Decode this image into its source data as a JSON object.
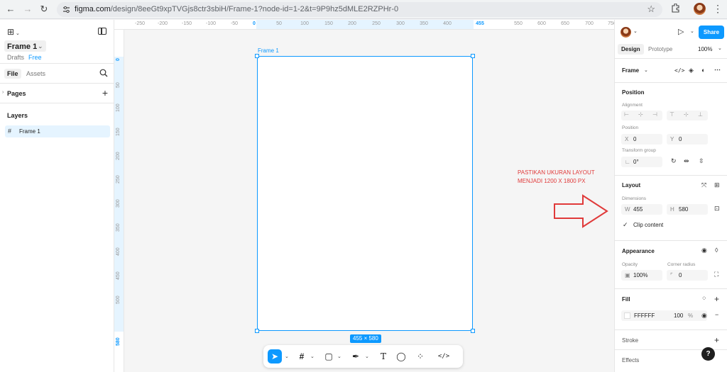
{
  "browser": {
    "url_domain": "figma.com",
    "url_path": "/design/8eeGt9xpTVGjs8ctr3sbiH/Frame-1?node-id=1-2&t=9P9hz5dMLE2RZPHr-0"
  },
  "left_panel": {
    "file_name": "Frame 1",
    "drafts_label": "Drafts",
    "plan_label": "Free",
    "tabs": [
      {
        "label": "File"
      },
      {
        "label": "Assets"
      }
    ],
    "pages_label": "Pages",
    "layers_label": "Layers",
    "layers": [
      {
        "label": "Frame 1"
      }
    ]
  },
  "canvas": {
    "frame_label": "Frame 1",
    "size_width": "455",
    "size_height": "580",
    "ruler_x": [
      "-250",
      "-200",
      "-150",
      "-100",
      "-50",
      "0",
      "50",
      "100",
      "150",
      "200",
      "250",
      "300",
      "350",
      "400",
      "455",
      "550",
      "600",
      "650",
      "700",
      "750"
    ],
    "ruler_y": [
      "0",
      "50",
      "100",
      "150",
      "200",
      "250",
      "300",
      "350",
      "400",
      "450",
      "500",
      "580"
    ],
    "annotation": "PASTIKAN UKURAN LAYOUT MENJADI 1200 X 1800 PX"
  },
  "right_panel": {
    "share_label": "Share",
    "tabs": [
      {
        "label": "Design"
      },
      {
        "label": "Prototype"
      }
    ],
    "zoom": "100%",
    "frame_type": "Frame",
    "position": {
      "title": "Position",
      "alignment_label": "Alignment",
      "position_label": "Position",
      "x_prefix": "X",
      "x_value": "0",
      "y_prefix": "Y",
      "y_value": "0",
      "transform_label": "Transform group",
      "rotation_value": "0°"
    },
    "layout": {
      "title": "Layout",
      "dimensions_label": "Dimensions",
      "w_prefix": "W",
      "w_value": "455",
      "h_prefix": "H",
      "h_value": "580",
      "clip_label": "Clip content"
    },
    "appearance": {
      "title": "Appearance",
      "opacity_label": "Opacity",
      "opacity_value": "100%",
      "radius_label": "Corner radius",
      "radius_value": "0"
    },
    "fill": {
      "title": "Fill",
      "hex": "FFFFFF",
      "opacity": "100",
      "percent": "%"
    },
    "stroke_title": "Stroke",
    "effects_title": "Effects"
  },
  "help_label": "?",
  "colors": {
    "accent": "#0d99ff",
    "annotation": "#e03a3a"
  }
}
